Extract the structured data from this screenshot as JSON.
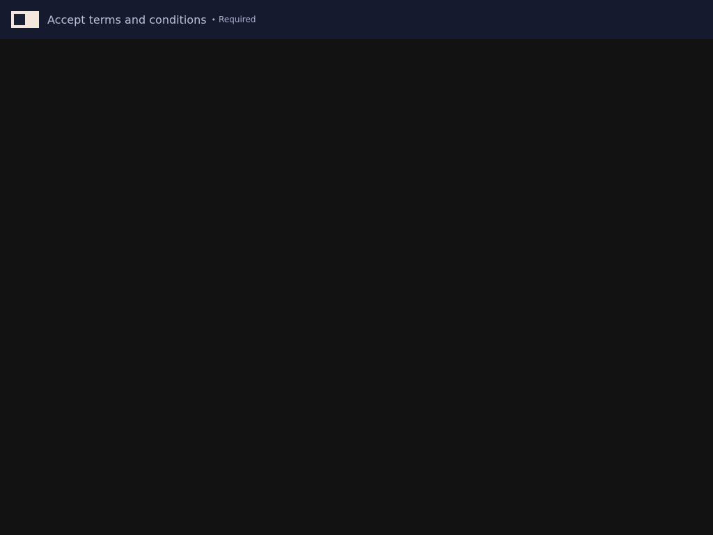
{
  "header": {
    "toggle": {
      "state": "off"
    },
    "label": "Accept terms and conditions",
    "required_separator": "•",
    "required_text": "Required"
  },
  "colors": {
    "topbar_background": "#161a2e",
    "page_background": "#121212",
    "toggle_track": "#f3e6da",
    "toggle_knob": "#1b1f33",
    "label_text": "#b9bfd9"
  }
}
